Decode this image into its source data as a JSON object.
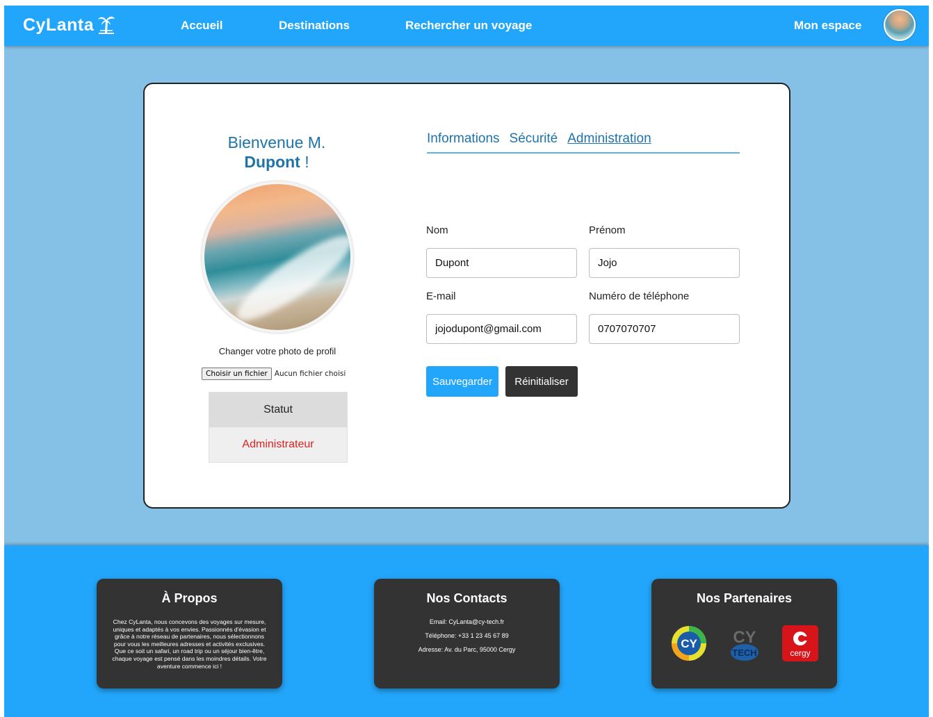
{
  "nav": {
    "logo": "CyLanta",
    "links": [
      "Accueil",
      "Destinations",
      "Rechercher un voyage"
    ],
    "my_space": "Mon espace"
  },
  "profile": {
    "welcome_prefix": "Bienvenue M.",
    "welcome_name": "Dupont",
    "welcome_suffix": "!",
    "change_photo_label": "Changer votre photo de profil",
    "file_button": "Choisir un fichier",
    "file_status": "Aucun fichier choisi",
    "status_header": "Statut",
    "status_value": "Administrateur"
  },
  "tabs": [
    "Informations",
    "Sécurité",
    "Administration"
  ],
  "form": {
    "nom_label": "Nom",
    "nom_value": "Dupont",
    "prenom_label": "Prénom",
    "prenom_value": "Jojo",
    "email_label": "E-mail",
    "email_value": "jojodupont@gmail.com",
    "phone_label": "Numéro de téléphone",
    "phone_value": "0707070707",
    "save_label": "Sauvegarder",
    "reset_label": "Réinitialiser"
  },
  "footer": {
    "about_title": "À Propos",
    "about_text": "Chez CyLanta, nous concevons des voyages sur mesure, uniques et adaptés à vos envies. Passionnés d'évasion et grâce à notre réseau de partenaires, nous sélectionnons pour vous les meilleures adresses et activités exclusives. Que ce soit un safari, un road trip ou un séjour bien-être, chaque voyage est pensé dans les moindres détails. Votre aventure commence ici !",
    "contacts_title": "Nos Contacts",
    "email_line": "Email: CyLanta@cy-tech.fr",
    "phone_line": "Téléphone: +33 1 23 45 67 89",
    "address_line": "Adresse: Av. du Parc, 95000 Cergy",
    "partners_title": "Nos Partenaires",
    "partner_logos": [
      "cy-logo",
      "cy-tech-logo",
      "cergy-logo"
    ],
    "partner_text": {
      "cy": "CY",
      "cytech_top": "CY",
      "cytech_bottom": "TECH",
      "cergy": "cergy"
    }
  },
  "colors": {
    "primary": "#22a6fb",
    "page_bg": "#85c1e6",
    "dark": "#333333",
    "status_red": "#e02020",
    "heading_blue": "#1e73a8"
  }
}
